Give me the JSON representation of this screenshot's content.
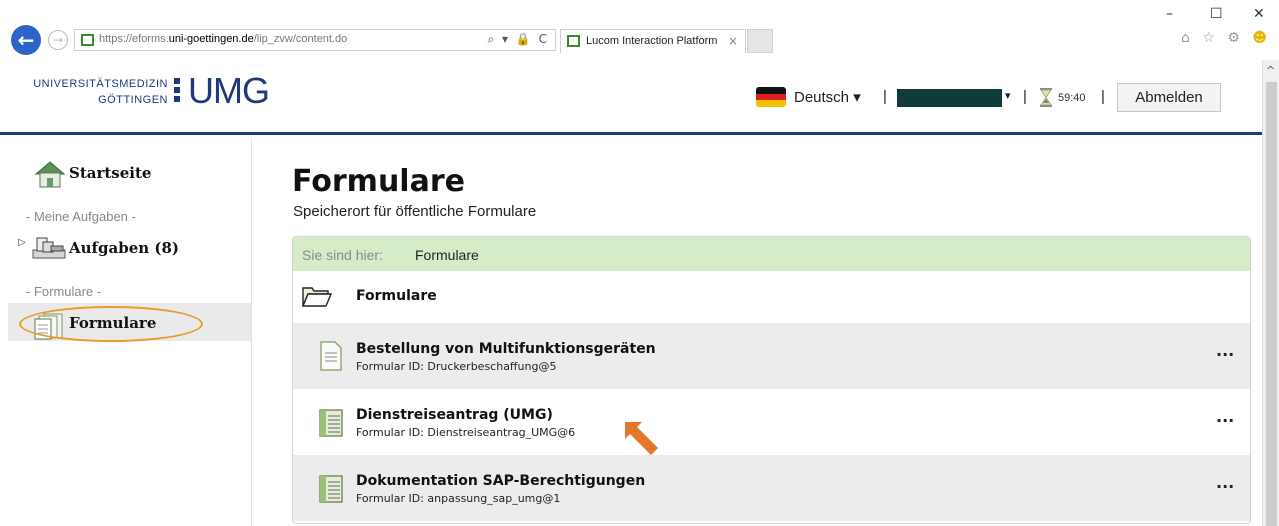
{
  "browser": {
    "url_prefix": "https://eforms.",
    "url_domain": "uni-goettingen.de",
    "url_path": "/lip_zvw/content.do",
    "url_controls": "⌕ ▾ 🔒 C",
    "tab_title": "Lucom Interaction Platform",
    "tab_close": "×",
    "back": "←",
    "forward": "→",
    "minimize": "–",
    "maximize": "☐",
    "close": "✕",
    "toolbar_icons": "⌂ ☆ ⚙",
    "smiley": "☻"
  },
  "header": {
    "logo_line1": "UNIVERSITÄTSMEDIZIN",
    "logo_line2": "GÖTTINGEN",
    "logo_mark": "UMG",
    "language": "Deutsch ▾",
    "separator": "|",
    "user_caret": "▾",
    "session_timer": "59:40",
    "logout": "Abmelden"
  },
  "sidebar": {
    "home": "Startseite",
    "section_tasks": "- Meine Aufgaben -",
    "expander": "▷",
    "tasks": "Aufgaben (8)",
    "section_forms": "- Formulare -",
    "forms": "Formulare"
  },
  "main": {
    "title": "Formulare",
    "subtitle": "Speicherort für öffentliche Formulare",
    "breadcrumb_prefix": "Sie sind hier:",
    "breadcrumb_current": "Formulare",
    "folder_label": "Formulare",
    "more_label": "···",
    "forms": [
      {
        "name": "Bestellung von Multifunktionsgeräten",
        "id": "Formular ID: Druckerbeschaffung@5"
      },
      {
        "name": "Dienstreiseantrag (UMG)",
        "id": "Formular ID: Dienstreiseantrag_UMG@6"
      },
      {
        "name": "Dokumentation SAP-Berechtigungen",
        "id": "Formular ID: anpassung_sap_umg@1"
      }
    ]
  },
  "colors": {
    "brand": "#1f3a7a",
    "breadcrumb_bg": "#d6ebc8",
    "annotation": "#e89a2b",
    "redacted_user": "#0f3b38"
  },
  "icons": [
    "back-icon",
    "forward-icon",
    "favicon-icon",
    "home-icon",
    "tasks-icon",
    "forms-icon",
    "folder-open-icon",
    "form-document-icon",
    "form-register-icon",
    "hourglass-icon",
    "germany-flag-icon",
    "more-icon"
  ]
}
